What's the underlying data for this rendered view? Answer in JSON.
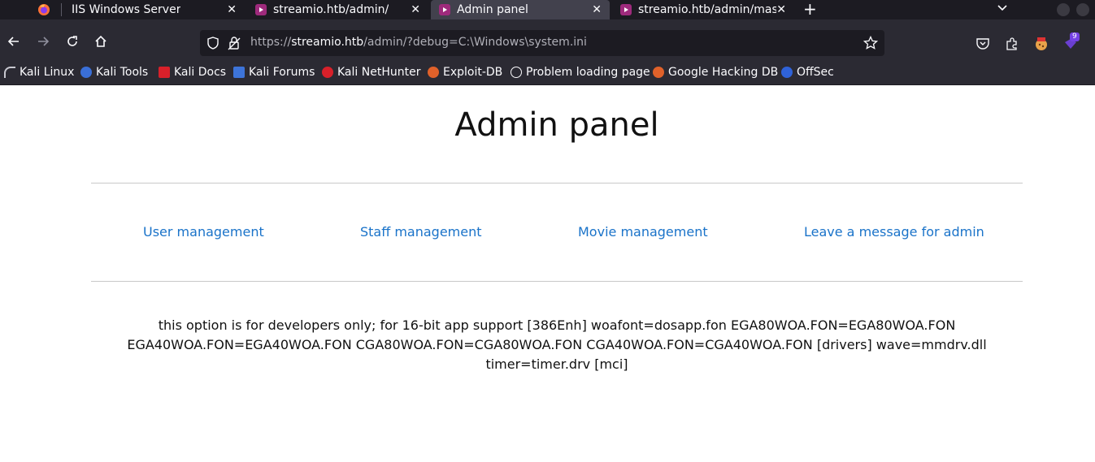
{
  "browser": {
    "tabs": [
      {
        "title": "IIS Windows Server",
        "active": false
      },
      {
        "title": "streamio.htb/admin/",
        "active": false
      },
      {
        "title": "Admin panel",
        "active": true
      },
      {
        "title": "streamio.htb/admin/mast",
        "active": false
      }
    ],
    "url": {
      "scheme": "https://",
      "host": "streamio.htb",
      "path": "/admin/?debug=C:\\Windows\\system.ini"
    },
    "bookmarks": [
      {
        "label": "Kali Linux",
        "icon": "kali-dragon-icon"
      },
      {
        "label": "Kali Tools",
        "icon": "kali-tools-icon"
      },
      {
        "label": "Kali Docs",
        "icon": "kali-docs-icon"
      },
      {
        "label": "Kali Forums",
        "icon": "kali-forums-icon"
      },
      {
        "label": "Kali NetHunter",
        "icon": "kali-nethunter-icon"
      },
      {
        "label": "Exploit-DB",
        "icon": "exploit-db-icon"
      },
      {
        "label": "Problem loading page",
        "icon": "globe-icon"
      },
      {
        "label": "Google Hacking DB",
        "icon": "ghdb-icon"
      },
      {
        "label": "OffSec",
        "icon": "offsec-icon"
      }
    ],
    "extension_badge": "9"
  },
  "page": {
    "title": "Admin panel",
    "links": [
      {
        "label": "User management"
      },
      {
        "label": "Staff management"
      },
      {
        "label": "Movie management"
      },
      {
        "label": "Leave a message for admin"
      }
    ],
    "debug_output": "this option is for developers only; for 16-bit app support [386Enh] woafont=dosapp.fon EGA80WOA.FON=EGA80WOA.FON EGA40WOA.FON=EGA40WOA.FON CGA80WOA.FON=CGA80WOA.FON CGA40WOA.FON=CGA40WOA.FON [drivers] wave=mmdrv.dll timer=timer.drv [mci]"
  },
  "colors": {
    "link": "#1a73c9",
    "chrome_dark": "#1c1b22",
    "chrome": "#2b2a33",
    "tab_favicon": "#9e2a7c"
  }
}
